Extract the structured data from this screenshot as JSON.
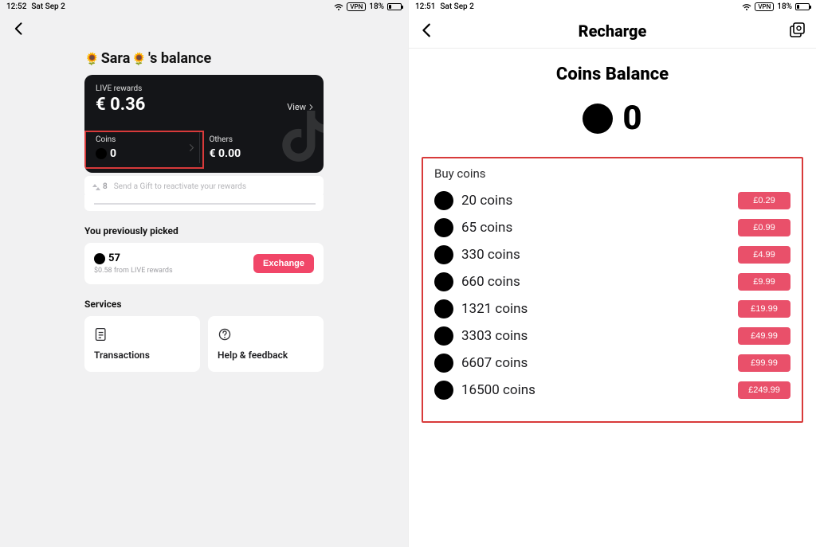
{
  "left": {
    "status": {
      "time": "12:52",
      "date": "Sat Sep 2",
      "vpn": "VPN",
      "battery": "18%"
    },
    "title_prefix": "Sara",
    "title_suffix": "'s balance",
    "live": {
      "label": "LIVE rewards",
      "amount": "€ 0.36",
      "view": "View"
    },
    "coins": {
      "label": "Coins",
      "value": "0"
    },
    "others": {
      "label": "Others",
      "value": "€ 0.00"
    },
    "gift": {
      "count": "8",
      "text": "Send a Gift to reactivate your rewards"
    },
    "picked": {
      "heading": "You previously picked",
      "amount": "57",
      "sub": "$0.58 from LIVE rewards",
      "button": "Exchange"
    },
    "services": {
      "heading": "Services",
      "transactions": "Transactions",
      "help": "Help & feedback"
    }
  },
  "right": {
    "status": {
      "time": "12:51",
      "date": "Sat Sep 2",
      "vpn": "VPN",
      "battery": "18%"
    },
    "nav_title": "Recharge",
    "balance_heading": "Coins Balance",
    "balance_value": "0",
    "buy_title": "Buy coins",
    "packs": [
      {
        "label": "20 coins",
        "price": "£0.29"
      },
      {
        "label": "65 coins",
        "price": "£0.99"
      },
      {
        "label": "330 coins",
        "price": "£4.99"
      },
      {
        "label": "660 coins",
        "price": "£9.99"
      },
      {
        "label": "1321 coins",
        "price": "£19.99"
      },
      {
        "label": "3303 coins",
        "price": "£49.99"
      },
      {
        "label": "6607 coins",
        "price": "£99.99"
      },
      {
        "label": "16500 coins",
        "price": "£249.99"
      }
    ]
  }
}
